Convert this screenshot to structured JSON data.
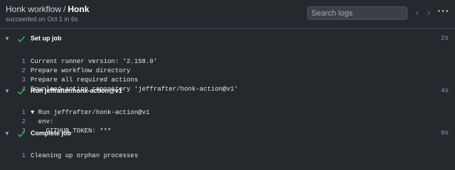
{
  "header": {
    "workflow": "Honk workflow",
    "separator": "/",
    "job": "Honk",
    "status": "succeeded on Oct 1 in 6s",
    "search_placeholder": "Search logs",
    "prev_icon": "chevron-left-icon",
    "next_icon": "chevron-right-icon",
    "more_icon": "kebab-menu-icon"
  },
  "colors": {
    "background": "#24292e",
    "success": "#28a745",
    "text": "#e1e4e8",
    "muted": "#959da5"
  },
  "steps": [
    {
      "name": "Set up job",
      "duration": "2s",
      "lines": [
        {
          "num": "1",
          "text": "Current runner version: '2.158.0'"
        },
        {
          "num": "2",
          "text": "Prepare workflow directory"
        },
        {
          "num": "3",
          "text": "Prepare all required actions"
        },
        {
          "num": "4",
          "text": "Download action repository 'jeffrafter/honk-action@v1'"
        }
      ]
    },
    {
      "name": "Run jeffrafter/honk-action@v1",
      "duration": "4s",
      "lines": [
        {
          "num": "1",
          "text": "▼ Run jeffrafter/honk-action@v1"
        },
        {
          "num": "2",
          "text": "  env:"
        },
        {
          "num": "3",
          "text": "    GITHUB_TOKEN: ***"
        }
      ]
    },
    {
      "name": "Complete job",
      "duration": "0s",
      "lines": [
        {
          "num": "1",
          "text": "Cleaning up orphan processes"
        }
      ]
    }
  ]
}
